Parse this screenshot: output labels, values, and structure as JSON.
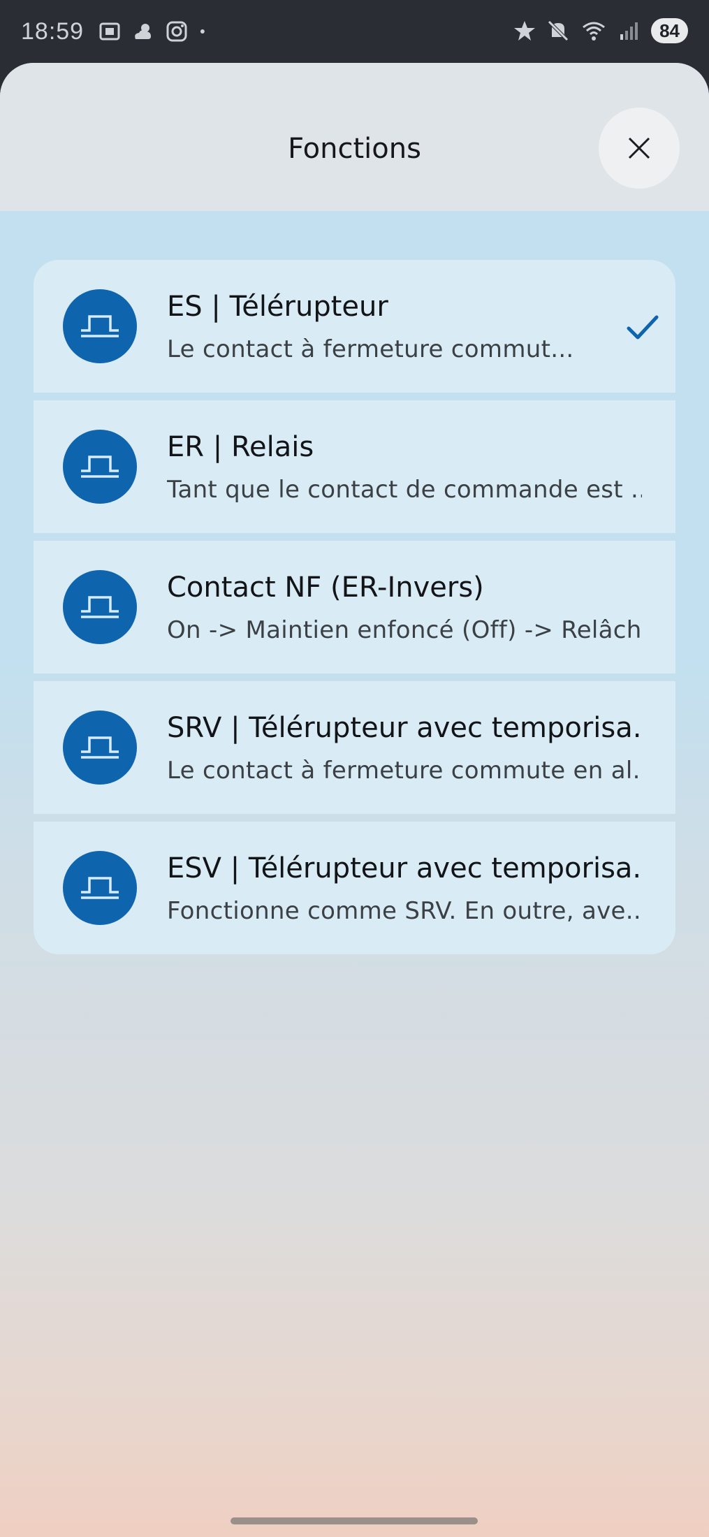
{
  "status_bar": {
    "time": "18:59",
    "battery": "84",
    "left_icons": [
      "screenshot-icon",
      "cloud-sun-icon",
      "instagram-icon",
      "dot-icon"
    ],
    "right_icons": [
      "star-icon",
      "mute-icon",
      "wifi-icon",
      "signal-icon"
    ]
  },
  "sheet": {
    "title": "Fonctions",
    "close_icon": "close-icon"
  },
  "functions": [
    {
      "title": "ES | Télérupteur",
      "subtitle": "Le contact à fermeture commut...",
      "selected": true
    },
    {
      "title": "ER | Relais",
      "subtitle": "Tant que le contact de commande est ...",
      "selected": false
    },
    {
      "title": "Contact NF (ER-Invers)",
      "subtitle": "On -> Maintien enfoncé (Off) -> Relâch...",
      "selected": false
    },
    {
      "title": "SRV | Télérupteur avec temporisa...",
      "subtitle": "Le contact à fermeture commute en al...",
      "selected": false
    },
    {
      "title": "ESV | Télérupteur avec temporisa...",
      "subtitle": "Fonctionne comme SRV. En outre, ave...",
      "selected": false
    }
  ],
  "colors": {
    "accent": "#0f65ad",
    "item_bg": "#d9ecf6",
    "header_bg": "#dfe4e8"
  }
}
